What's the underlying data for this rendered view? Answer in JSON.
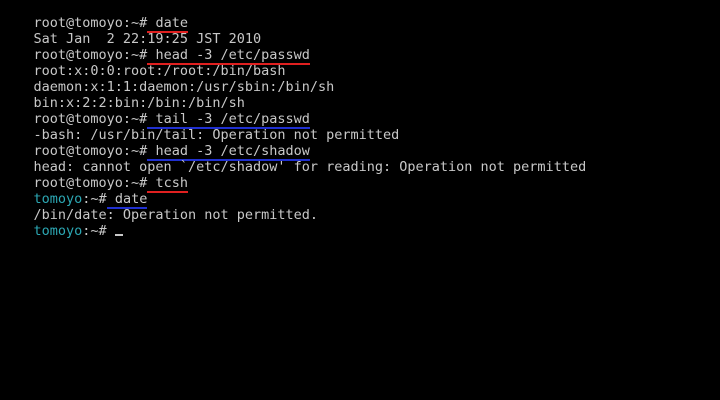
{
  "terminal": {
    "lines": [
      {
        "prompt": "root@tomoyo:~#",
        "command": " date",
        "underline": "red"
      },
      {
        "output": "Sat Jan  2 22:19:25 JST 2010"
      },
      {
        "prompt": "root@tomoyo:~#",
        "command": " head -3 /etc/passwd",
        "underline": "red"
      },
      {
        "output": "root:x:0:0:root:/root:/bin/bash"
      },
      {
        "output": "daemon:x:1:1:daemon:/usr/sbin:/bin/sh"
      },
      {
        "output": "bin:x:2:2:bin:/bin:/bin/sh"
      },
      {
        "prompt": "root@tomoyo:~#",
        "command": " tail -3 /etc/passwd",
        "underline": "blue"
      },
      {
        "output": "-bash: /usr/bin/tail: Operation not permitted"
      },
      {
        "prompt": "root@tomoyo:~#",
        "command": " head -3 /etc/shadow",
        "underline": "blue"
      },
      {
        "output": "head: cannot open `/etc/shadow' for reading: Operation not permitted"
      },
      {
        "prompt": "root@tomoyo:~#",
        "command": " tcsh",
        "underline": "red"
      },
      {
        "prompt_tomoyo": "tomoyo",
        "prompt_rest": ":~#",
        "command": " date",
        "underline": "blue"
      },
      {
        "output": "/bin/date: Operation not permitted."
      },
      {
        "prompt_tomoyo": "tomoyo",
        "prompt_rest": ":~#",
        "command": " "
      }
    ],
    "colors": {
      "text": "#c8c8c8",
      "background": "#000000",
      "tcsh_prompt": "#2ca8b4",
      "underline_red": "#e02020",
      "underline_blue": "#2030d0"
    }
  }
}
